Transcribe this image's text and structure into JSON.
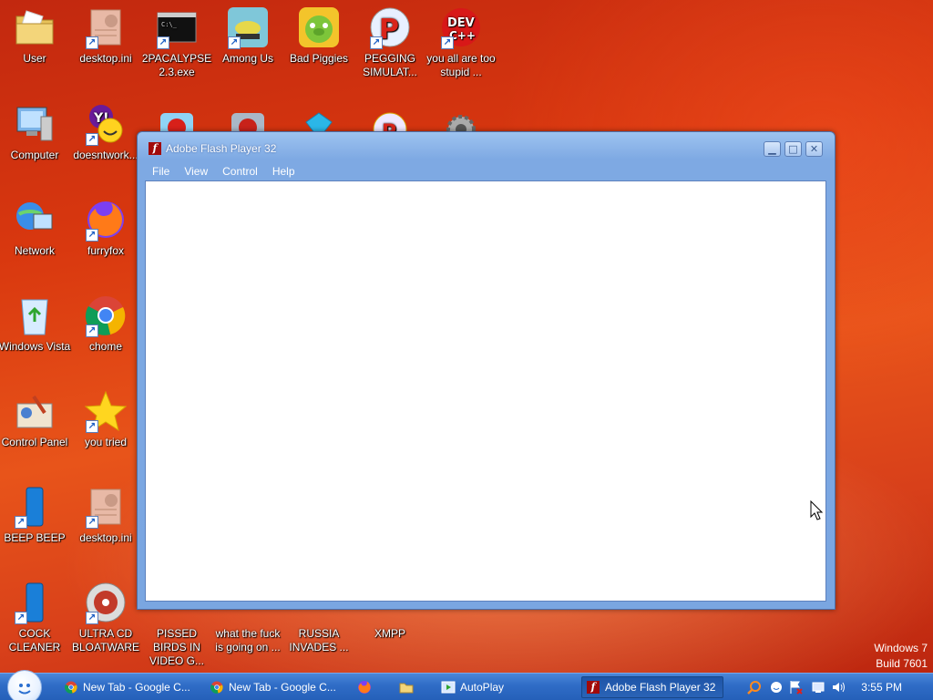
{
  "desktop": {
    "icons": [
      {
        "label": "User",
        "icon": "folder-icon"
      },
      {
        "label": "desktop.ini",
        "icon": "settings-file-icon"
      },
      {
        "label": "2PACALYPSE 2.3.exe",
        "icon": "console-icon"
      },
      {
        "label": "Among Us",
        "icon": "among-us-icon"
      },
      {
        "label": "Bad Piggies",
        "icon": "bad-piggies-icon"
      },
      {
        "label": "PEGGING SIMULAT...",
        "icon": "peggle-icon"
      },
      {
        "label": "you all are too stupid ...",
        "icon": "dev-cpp-icon"
      },
      {
        "label": "Computer",
        "icon": "computer-icon"
      },
      {
        "label": "doesntwork...",
        "icon": "yahoo-messenger-icon"
      },
      {
        "label": "Network",
        "icon": "network-icon"
      },
      {
        "label": "furryfox",
        "icon": "firefox-icon"
      },
      {
        "label": "Windows Vista",
        "icon": "recycle-bin-icon"
      },
      {
        "label": "chome",
        "icon": "chrome-icon"
      },
      {
        "label": "Control Panel",
        "icon": "control-panel-icon"
      },
      {
        "label": "you tried",
        "icon": "star-icon"
      },
      {
        "label": "BEEP BEEP",
        "icon": "blue-tube-icon"
      },
      {
        "label": "desktop.ini",
        "icon": "settings-file-icon"
      },
      {
        "label": "COCK CLEANER",
        "icon": "blue-tube-icon"
      },
      {
        "label": "ULTRA CD BLOATWARE",
        "icon": "cd-icon"
      },
      {
        "label": "PISSED BIRDS IN VIDEO G...",
        "icon": "angry-birds-icon"
      },
      {
        "label": "what the fuck is going on ...",
        "icon": "game-icon"
      },
      {
        "label": "RUSSIA INVADES ...",
        "icon": "game-icon"
      },
      {
        "label": "XMPP",
        "icon": "chat-icon"
      }
    ]
  },
  "window": {
    "title": "Adobe Flash Player 32",
    "menu": [
      "File",
      "View",
      "Control",
      "Help"
    ],
    "buttons": {
      "minimize": "minimize",
      "maximize": "maximize",
      "close": "close"
    }
  },
  "watermark": {
    "line1": "Windows 7",
    "line2": "Build 7601"
  },
  "taskbar": {
    "items": [
      {
        "label": "New Tab - Google C...",
        "icon": "chrome-icon"
      },
      {
        "label": "New Tab - Google C...",
        "icon": "chrome-icon"
      },
      {
        "label": "",
        "icon": "firefox-icon"
      },
      {
        "label": "",
        "icon": "explorer-folder-icon"
      },
      {
        "label": "AutoPlay",
        "icon": "autoplay-icon"
      },
      {
        "label": "Adobe Flash Player 32",
        "icon": "flash-icon",
        "active": true
      }
    ],
    "tray_icons": [
      "search-icon",
      "messenger-icon",
      "flag-icon",
      "network-tray-icon",
      "volume-icon"
    ],
    "clock": "3:55 PM"
  },
  "colors": {
    "wallpaper": "#d9380f",
    "window_frame": "#7ea9e3",
    "taskbar": "#2f6cc6"
  }
}
